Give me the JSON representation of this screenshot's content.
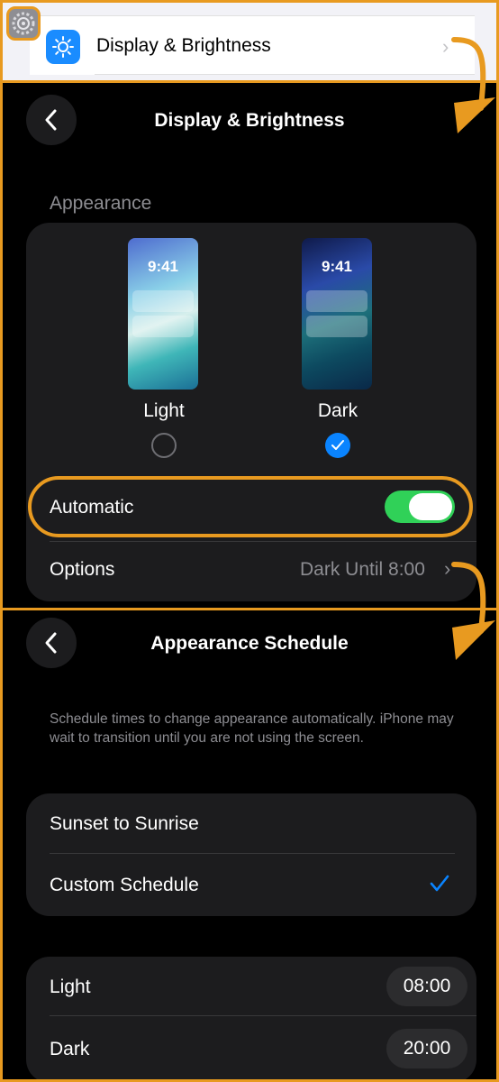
{
  "panel1": {
    "row_label": "Display & Brightness"
  },
  "display_brightness": {
    "title": "Display & Brightness",
    "section_header": "Appearance",
    "modes": [
      {
        "label": "Light",
        "time": "9:41",
        "selected": false
      },
      {
        "label": "Dark",
        "time": "9:41",
        "selected": true
      }
    ],
    "automatic_label": "Automatic",
    "automatic_on": true,
    "options_label": "Options",
    "options_value": "Dark Until 8:00"
  },
  "appearance_schedule": {
    "title": "Appearance Schedule",
    "description": "Schedule times to change appearance automatically. iPhone may wait to transition until you are not using the screen.",
    "schedule_options": [
      {
        "label": "Sunset to Sunrise",
        "checked": false
      },
      {
        "label": "Custom Schedule",
        "checked": true
      }
    ],
    "times": [
      {
        "label": "Light",
        "value": "08:00"
      },
      {
        "label": "Dark",
        "value": "20:00"
      }
    ]
  },
  "colors": {
    "highlight": "#e89a20",
    "accent_blue": "#0a84ff",
    "toggle_green": "#30d158",
    "dark_card": "#1c1c1e"
  },
  "icons": [
    "settings-gear-icon",
    "brightness-sun-icon",
    "chevron-right-icon",
    "back-chevron-icon",
    "checkmark-icon",
    "arrow-icon"
  ]
}
